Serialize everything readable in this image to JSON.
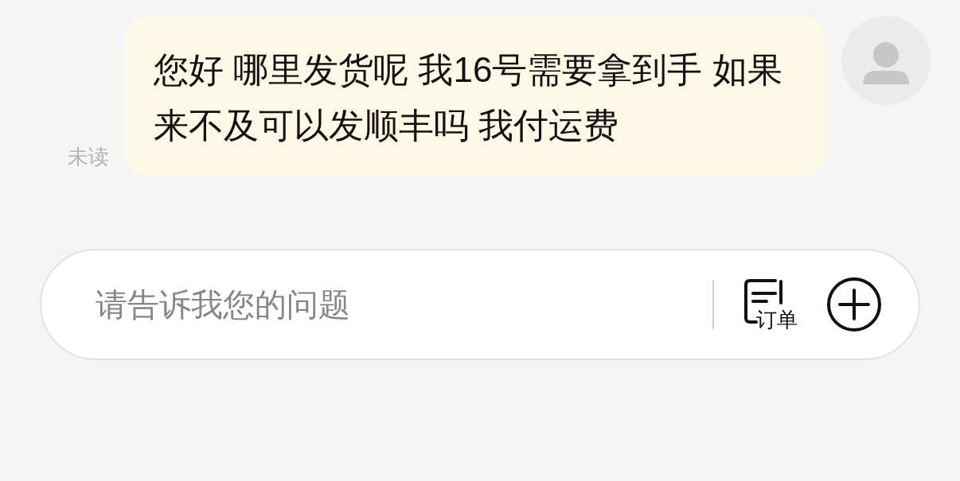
{
  "messages": [
    {
      "kind": "outgoing",
      "text": "您好 哪里发货呢 我16号需要拿到手 如果来不及可以发顺丰吗 我付运费",
      "status": "未读"
    }
  ],
  "composer": {
    "placeholder": "请告诉我您的问题",
    "order_button": "订单"
  }
}
